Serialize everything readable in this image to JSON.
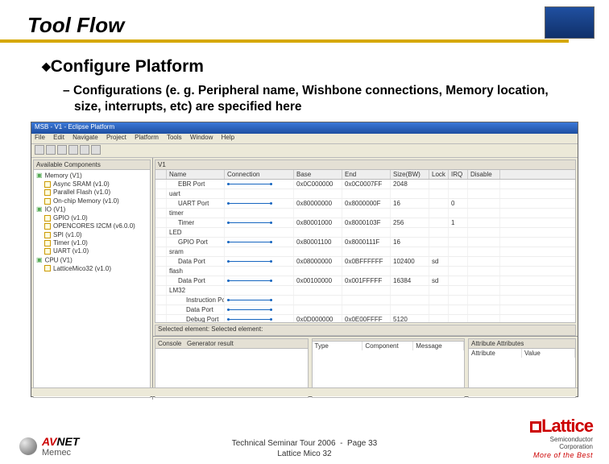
{
  "title": "Tool Flow",
  "bullets": {
    "main": "Configure Platform",
    "sub": "Configurations (e. g. Peripheral name, Wishbone connections, Memory location, size, interrupts, etc) are specified here"
  },
  "app": {
    "windowTitle": "MSB - V1 - Eclipse Platform",
    "menu": [
      "File",
      "Edit",
      "Navigate",
      "Project",
      "Platform",
      "Tools",
      "Window",
      "Help"
    ],
    "leftPanel": {
      "title": "Available Components",
      "tree": [
        "Memory (V1)",
        "Async SRAM (v1.0)",
        "Parallel Flash (v1.0)",
        "On-chip Memory (v1.0)",
        "IO (V1)",
        "GPIO (v1.0)",
        "OPENCORES I2CM (v6.0.0)",
        "SPI (v1.0)",
        "Timer (v1.0)",
        "UART (v1.0)",
        "CPU (V1)",
        "LatticeMico32 (v1.0)"
      ]
    },
    "editorTab": "V1",
    "grid": {
      "columns": [
        "Name",
        "Connection",
        "Base",
        "End",
        "Size(BW)",
        "Lock",
        "IRQ",
        "Disable"
      ],
      "rows": [
        {
          "name": "EBR Port",
          "conn": true,
          "base": "0x0C000000",
          "end": "0x0C0007FF",
          "size": "2048",
          "lock": "",
          "irq": "",
          "dis": "",
          "indent": 1
        },
        {
          "name": "uart",
          "conn": false,
          "base": "",
          "end": "",
          "size": "",
          "lock": "",
          "irq": "",
          "dis": "",
          "parent": true
        },
        {
          "name": "UART Port",
          "conn": true,
          "base": "0x80000000",
          "end": "0x8000000F",
          "size": "16",
          "lock": "",
          "irq": "0",
          "dis": "",
          "indent": 1
        },
        {
          "name": "timer",
          "conn": false,
          "base": "",
          "end": "",
          "size": "",
          "lock": "",
          "irq": "",
          "dis": "",
          "parent": true
        },
        {
          "name": "Timer",
          "conn": true,
          "base": "0x80001000",
          "end": "0x8000103F",
          "size": "256",
          "lock": "",
          "irq": "1",
          "dis": "",
          "indent": 1
        },
        {
          "name": "LED",
          "conn": false,
          "base": "",
          "end": "",
          "size": "",
          "lock": "",
          "irq": "",
          "dis": "",
          "parent": true
        },
        {
          "name": "GPIO Port",
          "conn": true,
          "base": "0x80001100",
          "end": "0x8000111F",
          "size": "16",
          "lock": "",
          "irq": "",
          "dis": "",
          "indent": 1
        },
        {
          "name": "sram",
          "conn": false,
          "base": "",
          "end": "",
          "size": "",
          "lock": "",
          "irq": "",
          "dis": "",
          "parent": true
        },
        {
          "name": "Data Port",
          "conn": true,
          "base": "0x08000000",
          "end": "0x0BFFFFFF",
          "size": "102400",
          "lock": "sd",
          "irq": "",
          "dis": "",
          "indent": 1
        },
        {
          "name": "flash",
          "conn": false,
          "base": "",
          "end": "",
          "size": "",
          "lock": "",
          "irq": "",
          "dis": "",
          "parent": true
        },
        {
          "name": "Data Port",
          "conn": true,
          "base": "0x00100000",
          "end": "0x001FFFFF",
          "size": "16384",
          "lock": "sd",
          "irq": "",
          "dis": "",
          "indent": 1
        },
        {
          "name": "LM32",
          "conn": false,
          "base": "",
          "end": "",
          "size": "",
          "lock": "",
          "irq": "",
          "dis": "",
          "parent": true
        },
        {
          "name": "Instruction Port",
          "conn": true,
          "base": "",
          "end": "",
          "size": "",
          "lock": "",
          "irq": "",
          "dis": "",
          "indent": 2
        },
        {
          "name": "Data Port",
          "conn": true,
          "base": "",
          "end": "",
          "size": "",
          "lock": "",
          "irq": "",
          "dis": "",
          "indent": 2
        },
        {
          "name": "Debug Port",
          "conn": true,
          "base": "0x0D000000",
          "end": "0x0E00FFFF",
          "size": "5120",
          "lock": "",
          "irq": "",
          "dis": "",
          "indent": 2
        }
      ]
    },
    "selectedBar": "Selected element: Selected element:",
    "bottom": {
      "leftTabs": [
        "Console",
        "Generator result"
      ],
      "midCols": [
        "Type",
        "Component",
        "Message"
      ],
      "rightTitle": "Attribute Attributes",
      "rightCols": [
        "Attribute",
        "Value"
      ]
    }
  },
  "footer": {
    "line1a": "Technical Seminar Tour 2006",
    "line1b": "Page 33",
    "line2": "Lattice Mico 32"
  },
  "logos": {
    "avnet": {
      "a": "AV",
      "b": "NET",
      "sub": "Memec"
    },
    "lattice": {
      "name": "Lattice",
      "sub1": "Semiconductor",
      "sub2": "Corporation",
      "tag": "More of the Best"
    }
  }
}
